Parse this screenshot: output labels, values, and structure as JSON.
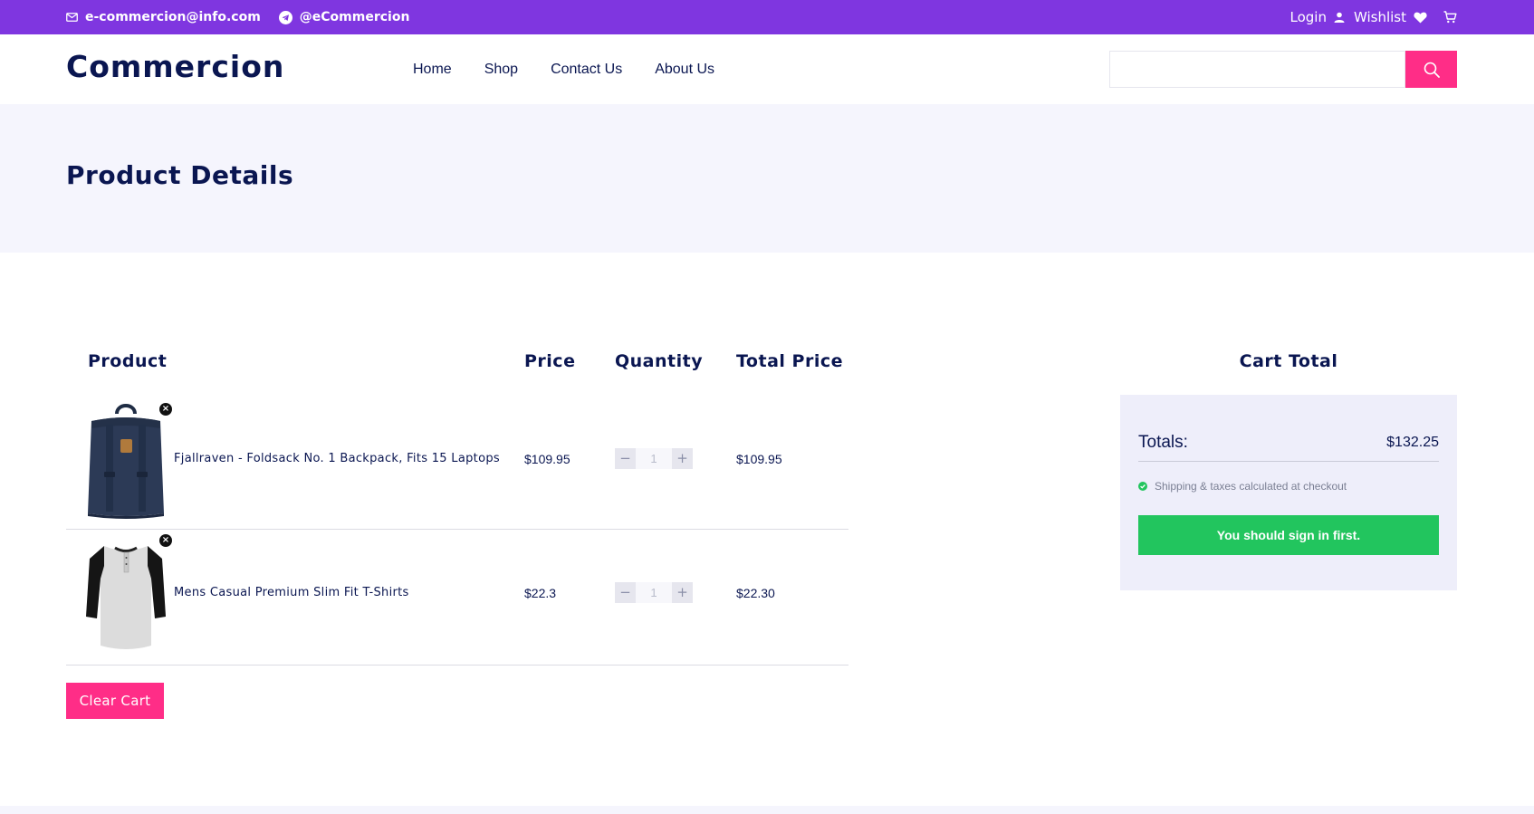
{
  "topbar": {
    "email": "e-commercion@info.com",
    "telegram": "@eCommercion",
    "login": "Login",
    "wishlist": "Wishlist"
  },
  "header": {
    "logo": "Commercion",
    "nav": [
      "Home",
      "Shop",
      "Contact Us",
      "About Us"
    ],
    "search_placeholder": ""
  },
  "banner": {
    "title": "Product Details"
  },
  "cart": {
    "columns": [
      "Product",
      "Price",
      "Quantity",
      "Total Price"
    ],
    "items": [
      {
        "name": "Fjallraven - Foldsack No. 1 Backpack, Fits 15 Laptops",
        "price": "$109.95",
        "quantity": "1",
        "total": "$109.95",
        "image": "backpack"
      },
      {
        "name": "Mens Casual Premium Slim Fit T-Shirts",
        "price": "$22.3",
        "quantity": "1",
        "total": "$22.30",
        "image": "raglan-shirt"
      }
    ],
    "minus": "−",
    "plus": "+",
    "remove": "×",
    "clear_label": "Clear Cart"
  },
  "summary": {
    "title": "Cart Total",
    "totals_label": "Totals:",
    "totals_value": "$132.25",
    "shipping_note": "Shipping & taxes calculated at checkout",
    "signin_label": "You should sign in first."
  },
  "colors": {
    "topbar": "#7f36e0",
    "accent": "#ff2d87",
    "navy": "#0a1651",
    "success": "#22c55e",
    "banner_bg": "#f5f5fd"
  }
}
